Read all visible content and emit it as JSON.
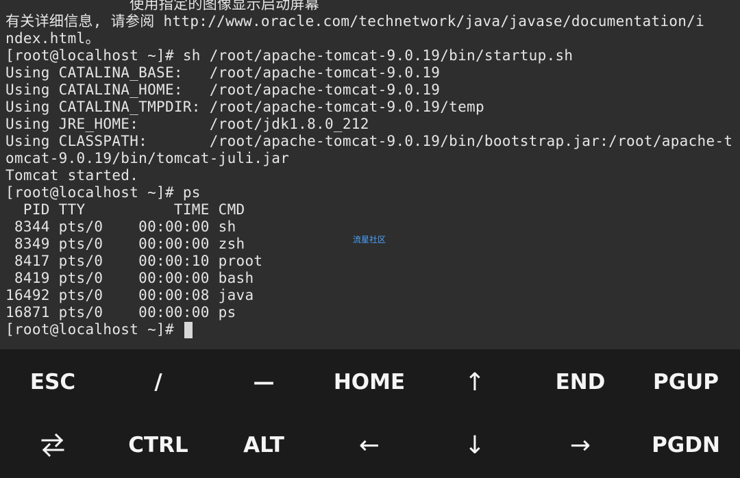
{
  "terminal": {
    "lines": [
      "              使用指定的图像显示启动屏幕",
      "有关详细信息, 请参阅 http://www.oracle.com/technetwork/java/javase/documentation/i",
      "ndex.html。",
      "[root@localhost ~]# sh /root/apache-tomcat-9.0.19/bin/startup.sh",
      "Using CATALINA_BASE:   /root/apache-tomcat-9.0.19",
      "Using CATALINA_HOME:   /root/apache-tomcat-9.0.19",
      "Using CATALINA_TMPDIR: /root/apache-tomcat-9.0.19/temp",
      "Using JRE_HOME:        /root/jdk1.8.0_212",
      "Using CLASSPATH:       /root/apache-tomcat-9.0.19/bin/bootstrap.jar:/root/apache-t",
      "omcat-9.0.19/bin/tomcat-juli.jar",
      "Tomcat started.",
      "[root@localhost ~]# ps",
      "  PID TTY          TIME CMD",
      " 8344 pts/0    00:00:00 sh",
      " 8349 pts/0    00:00:00 zsh",
      " 8417 pts/0    00:00:10 proot",
      " 8419 pts/0    00:00:00 bash",
      "16492 pts/0    00:00:08 java",
      "16871 pts/0    00:00:00 ps"
    ],
    "prompt": "[root@localhost ~]# ",
    "watermark": "流星社区"
  },
  "keys": {
    "row1": [
      "ESC",
      "/",
      "—",
      "HOME",
      "↑",
      "END",
      "PGUP"
    ],
    "row2": [
      "swap-icon",
      "CTRL",
      "ALT",
      "←",
      "↓",
      "→",
      "PGDN"
    ]
  }
}
